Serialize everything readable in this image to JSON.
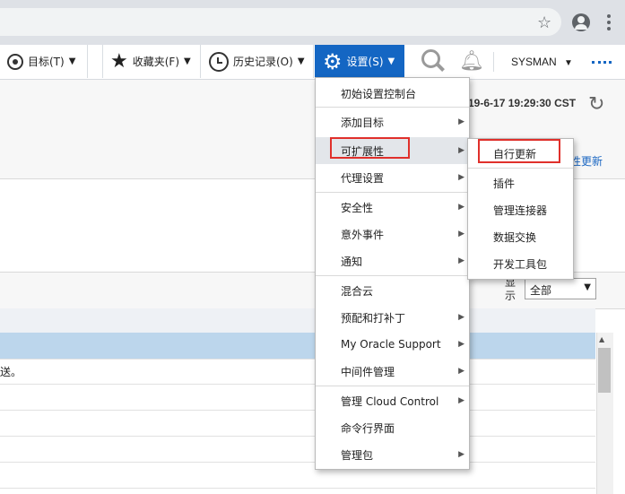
{
  "browser": {
    "star_icon": "star-outline-icon",
    "account_icon": "account-circle-icon",
    "menu_icon": "vertical-dots-icon"
  },
  "toolbar": {
    "targets_label": "目标(T)",
    "favorites_label": "收藏夹(F)",
    "history_label": "历史记录(O)",
    "settings_label": "设置(S)",
    "user_label": "SYSMAN"
  },
  "page": {
    "timestamp": "19-6-17 19:29:30 CST",
    "link_text": "性更新",
    "show_label": "显示",
    "show_value": "全部",
    "row_text": "送。"
  },
  "settings_menu": {
    "items": [
      {
        "label": "初始设置控制台",
        "has_submenu": false
      },
      {
        "label": "添加目标",
        "has_submenu": true
      },
      {
        "label": "可扩展性",
        "has_submenu": true
      },
      {
        "label": "代理设置",
        "has_submenu": true
      },
      {
        "label": "安全性",
        "has_submenu": true
      },
      {
        "label": "意外事件",
        "has_submenu": true
      },
      {
        "label": "通知",
        "has_submenu": true
      },
      {
        "label": "混合云",
        "has_submenu": false
      },
      {
        "label": "预配和打补丁",
        "has_submenu": true
      },
      {
        "label": "My Oracle Support",
        "has_submenu": true
      },
      {
        "label": "中间件管理",
        "has_submenu": true
      },
      {
        "label": "管理 Cloud Control",
        "has_submenu": true
      },
      {
        "label": "命令行界面",
        "has_submenu": false
      },
      {
        "label": "管理包",
        "has_submenu": true
      }
    ]
  },
  "extensibility_submenu": {
    "items": [
      {
        "label": "自行更新"
      },
      {
        "label": "插件"
      },
      {
        "label": "管理连接器"
      },
      {
        "label": "数据交换"
      },
      {
        "label": "开发工具包"
      }
    ]
  },
  "colors": {
    "settings_button_bg": "#1466c3",
    "highlight_red": "#e0302b",
    "selected_row": "#bcd6ec",
    "link_blue": "#1a66c2"
  }
}
